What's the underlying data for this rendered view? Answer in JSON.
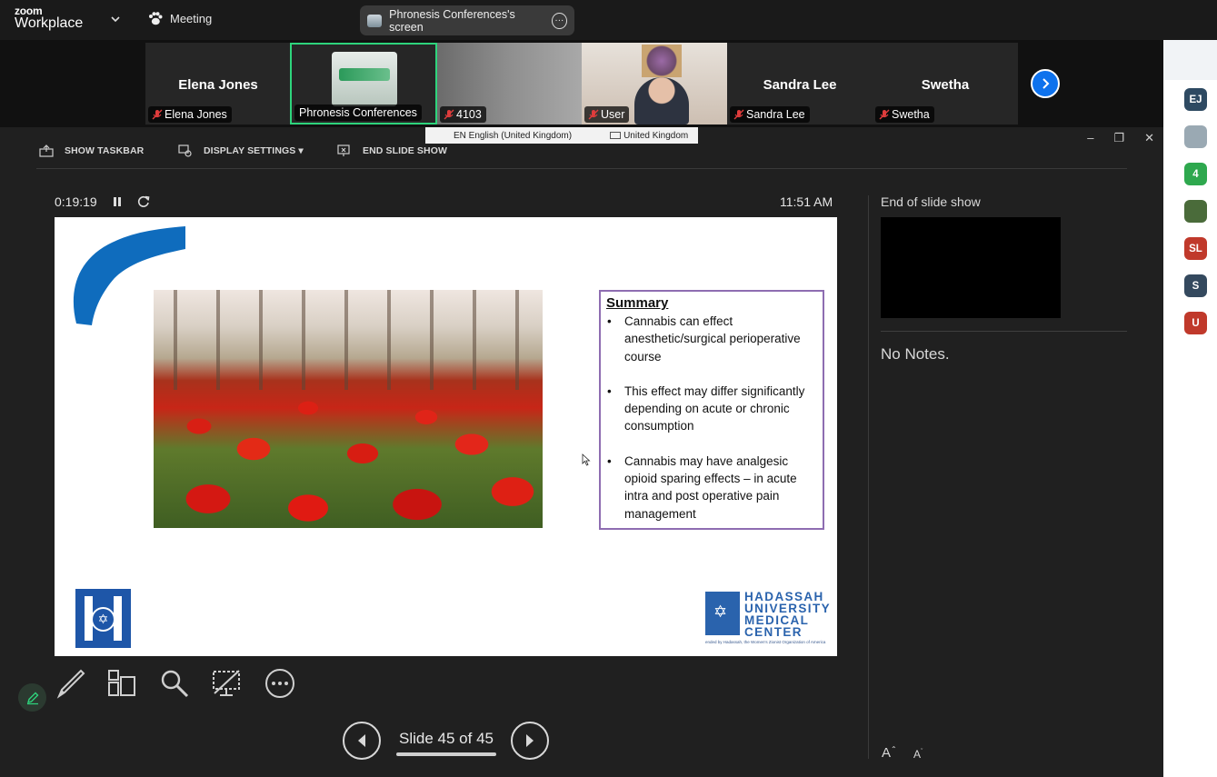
{
  "app": {
    "brand_top": "zoom",
    "brand_bottom": "Workplace",
    "meeting_label": "Meeting",
    "share_label": "Phronesis Conferences's screen"
  },
  "participants": [
    {
      "big_name": "Elena Jones",
      "label": "Elena Jones"
    },
    {
      "big_name": "",
      "label": "Phronesis Conferences"
    },
    {
      "big_name": "",
      "label": "4103"
    },
    {
      "big_name": "",
      "label": "User"
    },
    {
      "big_name": "Sandra Lee",
      "label": "Sandra Lee"
    },
    {
      "big_name": "Swetha",
      "label": "Swetha"
    }
  ],
  "language_bar": {
    "input_lang": "EN English (United Kingdom)",
    "keyboard": "United Kingdom"
  },
  "rail": [
    {
      "initials": "EJ",
      "color": "#2e4a62"
    },
    {
      "initials": "",
      "color": "#9aa9b3"
    },
    {
      "initials": "4",
      "color": "#2ea84e"
    },
    {
      "initials": "",
      "color": "#4a6b3a"
    },
    {
      "initials": "SL",
      "color": "#c0392b"
    },
    {
      "initials": "S",
      "color": "#34495e"
    },
    {
      "initials": "U",
      "color": "#c0392b"
    }
  ],
  "toolbar": {
    "show_taskbar": "SHOW TASKBAR",
    "display_settings": "DISPLAY SETTINGS ▾",
    "end_slide_show": "END SLIDE SHOW"
  },
  "window_controls": {
    "minimize": "–",
    "restore": "❐",
    "close": "✕"
  },
  "presenter": {
    "timer": "0:19:19",
    "clock": "11:51 AM",
    "slide_counter": "Slide 45 of 45"
  },
  "slide": {
    "summary_title": "Summary",
    "bullets": [
      "Cannabis can effect anesthetic/surgical perioperative course",
      "This effect may differ significantly depending on acute or chronic  consumption",
      "Cannabis may have analgesic opioid sparing effects – in acute intra and post operative pain management"
    ],
    "logo_lines": [
      "HADASSAH",
      "UNIVERSITY",
      "MEDICAL",
      "CENTER"
    ],
    "logo_tagline": "ended by Hadassah, the Women's Zionist Organization of America"
  },
  "notes_panel": {
    "next_label": "End of slide show",
    "notes_text": "No Notes.",
    "font_up": "A",
    "font_down": "A"
  },
  "colors": {
    "accent": "#0e72ed",
    "active_tile_border": "#2ed47c",
    "summary_border": "#8e6db1",
    "ink_blue": "#0f6cbd"
  }
}
